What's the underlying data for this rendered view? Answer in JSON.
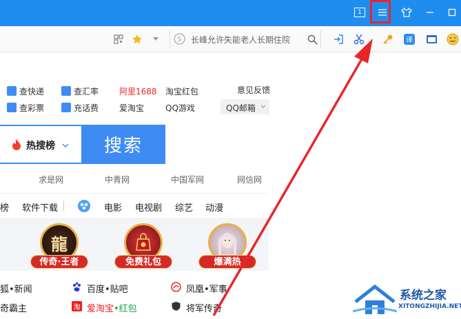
{
  "colors": {
    "titlebar": "#1f8df0",
    "search_blue": "#3e8cf3",
    "highlight_red": "#e8262a"
  },
  "titlebar": {
    "tab_count": "1",
    "icons": [
      "tab-count-icon",
      "menu-icon",
      "skin-icon",
      "minimize-icon",
      "maximize-icon"
    ]
  },
  "toolbar": {
    "address_text": "长峰允许失能老人长期住院"
  },
  "quick_links": {
    "express": "查快递",
    "exchange": "查汇率",
    "ali": "阿里1688",
    "taobao_hongbao": "淘宝红包",
    "feedback": "意见反馈",
    "lottery": "查彩票",
    "recharge": "充话费",
    "aitaobao": "爱淘宝",
    "qqgame": "QQ游戏",
    "qqmail": "QQ邮箱"
  },
  "search": {
    "hot_label": "热搜榜",
    "button_label": "搜索"
  },
  "sites": [
    "求是网",
    "中青网",
    "中国军网",
    "网信网"
  ],
  "nav": {
    "bang": "榜",
    "software": "软件下载",
    "movie": "电影",
    "tv": "电视剧",
    "variety": "综艺",
    "anime": "动漫"
  },
  "games": [
    {
      "label": "传奇·王者",
      "emblem": "龍"
    },
    {
      "label": "免费礼包",
      "emblem": ""
    },
    {
      "label": "爆满热",
      "emblem": ""
    }
  ],
  "links_row1": {
    "a": "狐•新闻",
    "b": "百度•贴吧",
    "c": "凤凰•军事"
  },
  "links_row2": {
    "a": "奇霸主",
    "b_pre": "爱淘宝",
    "b_post": "•红包",
    "c": "将军传奇"
  },
  "watermark": {
    "line1": "系统之家",
    "line2": "XITONGZHIJIA.NET"
  }
}
